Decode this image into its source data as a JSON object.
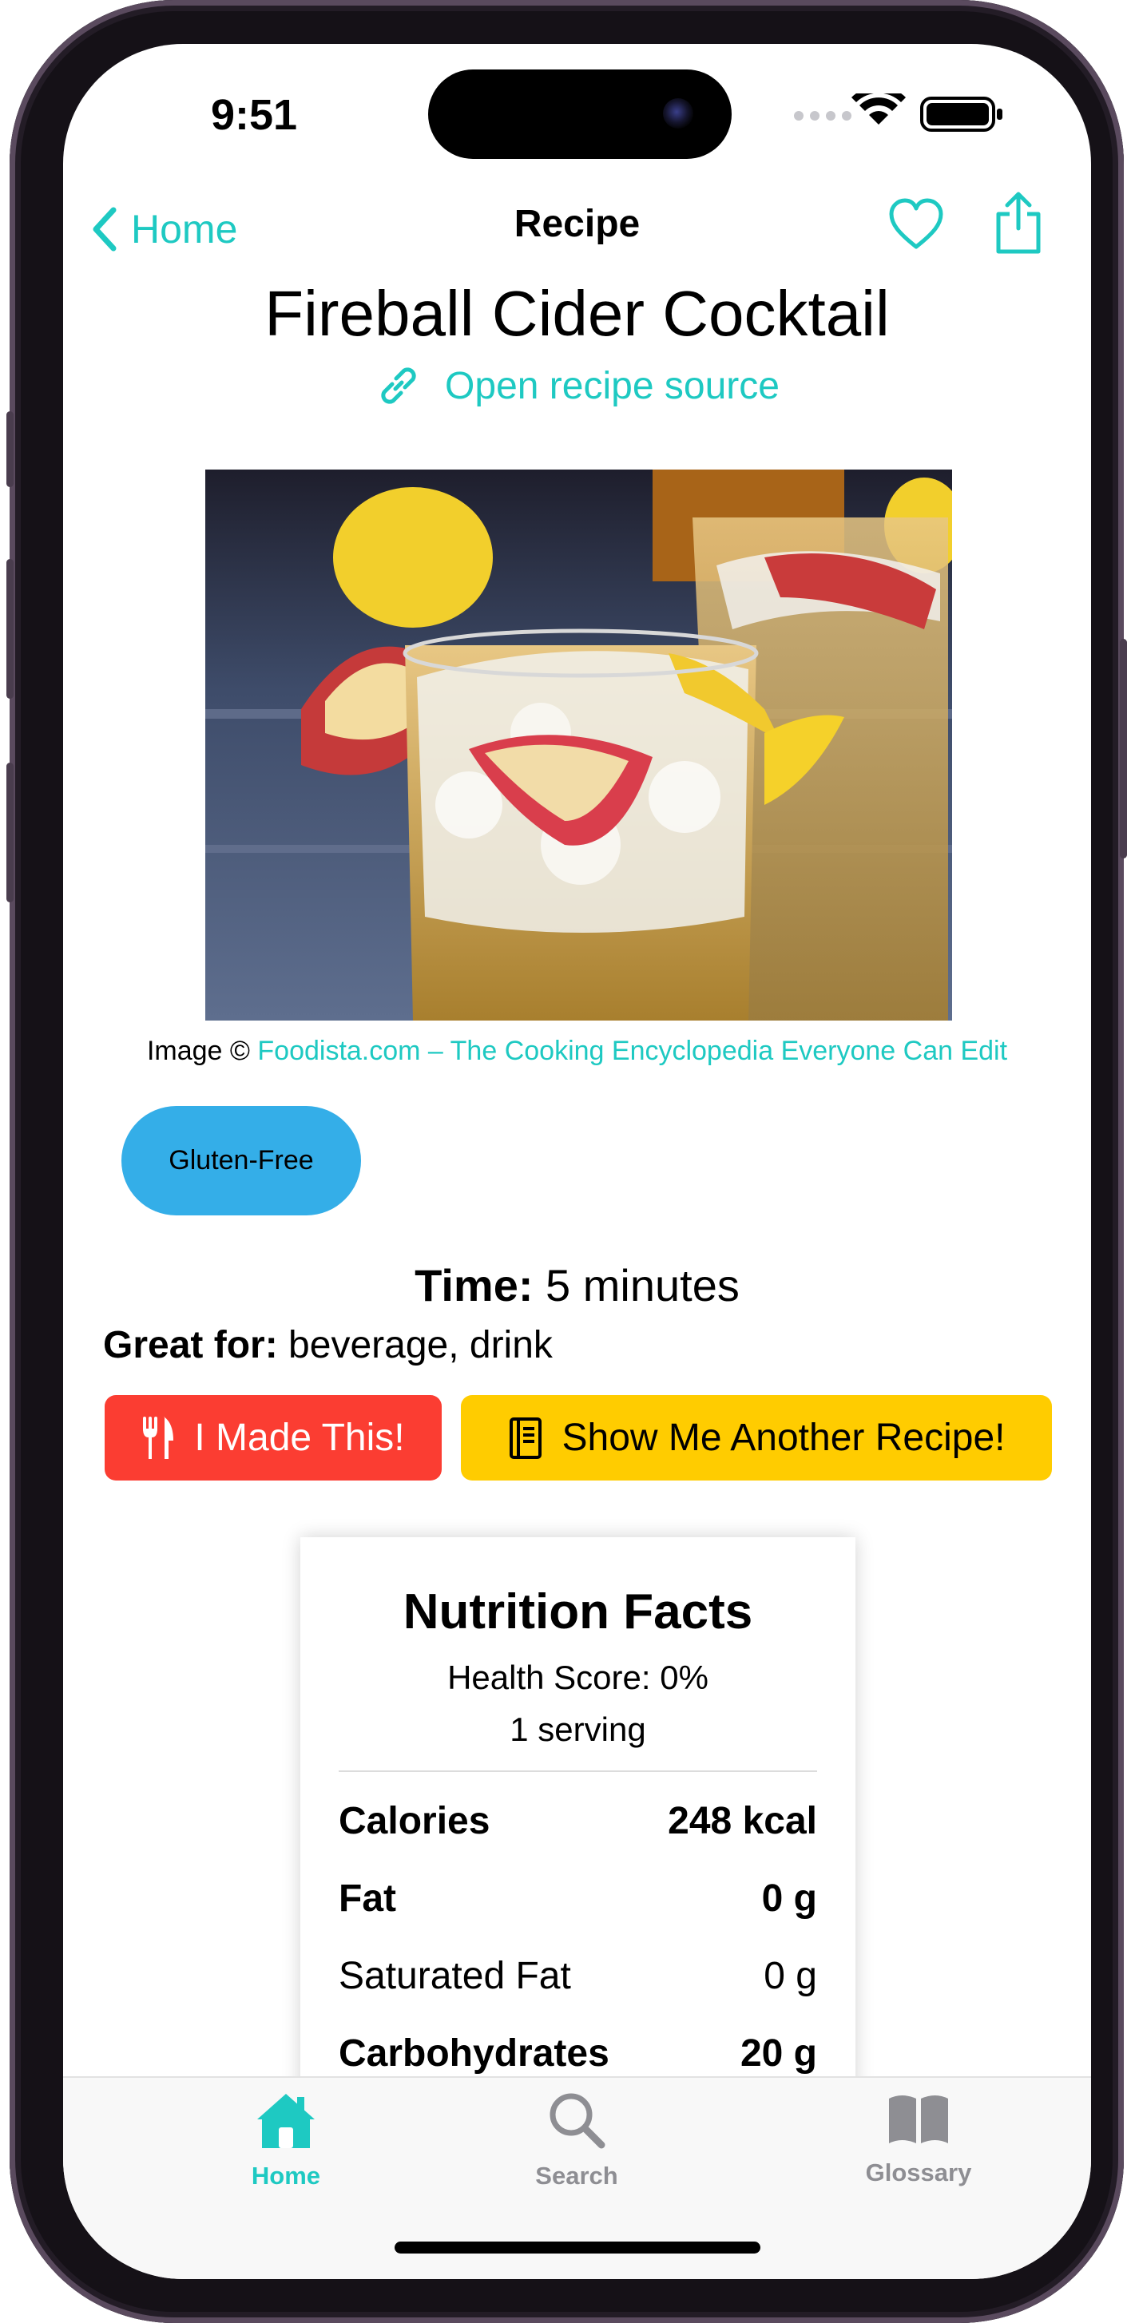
{
  "status_bar": {
    "time": "9:51"
  },
  "nav": {
    "back_label": "Home",
    "title": "Recipe"
  },
  "recipe": {
    "title": "Fireball Cider Cocktail",
    "source_link_label": "Open recipe source",
    "image_credit_prefix": "Image ©",
    "image_credit_link": "Foodista.com – The Cooking Encyclopedia Everyone Can Edit",
    "diet_badge": "Gluten-Free",
    "time_label": "Time:",
    "time_value": "5 minutes",
    "great_for_label": "Great for:",
    "great_for_value": "beverage, drink"
  },
  "actions": {
    "made_this_label": "I Made This!",
    "another_recipe_label": "Show Me Another Recipe!"
  },
  "nutrition": {
    "title": "Nutrition Facts",
    "health_score": "Health Score: 0%",
    "servings": "1 serving",
    "rows": [
      {
        "label": "Calories",
        "value": "248 kcal",
        "bold": true
      },
      {
        "label": "Fat",
        "value": "0 g",
        "bold": true
      },
      {
        "label": "Saturated Fat",
        "value": "0 g",
        "bold": false
      },
      {
        "label": "Carbohydrates",
        "value": "20 g",
        "bold": true
      }
    ]
  },
  "tabbar": {
    "home": "Home",
    "search": "Search",
    "glossary": "Glossary"
  },
  "colors": {
    "accent": "#1ec9c2",
    "made_this_button": "#fb3d32",
    "another_recipe_button": "#ffcc00",
    "badge": "#34aee8"
  },
  "icons": [
    "chevron-left-icon",
    "heart-icon",
    "share-icon",
    "link-icon",
    "fork-knife-icon",
    "book-icon",
    "house-icon",
    "magnifying-glass-icon",
    "open-book-icon",
    "signal-icon",
    "wifi-icon",
    "battery-icon"
  ]
}
